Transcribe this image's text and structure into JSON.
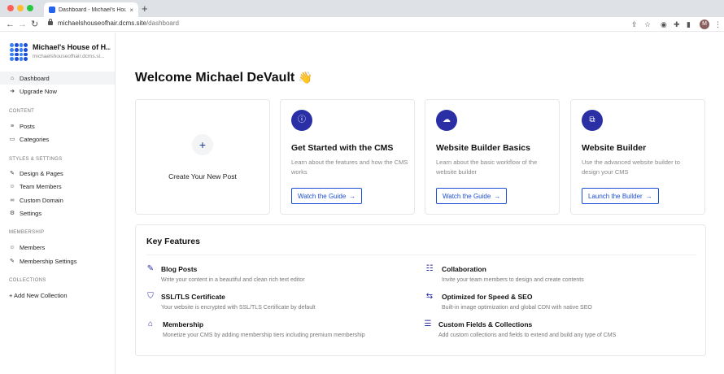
{
  "browser": {
    "tab_title": "Dashboard - Michael's House of",
    "tab_close": "×",
    "new_tab": "+",
    "url_host": "michaelshouseofhair.dcms.site",
    "url_path": "/dashboard",
    "avatar_initial": "M"
  },
  "sidebar": {
    "brand_name": "Michael's House of H...",
    "brand_domain": "michaelshouseofhair.dcms.si...",
    "top_items": [
      {
        "label": "Dashboard",
        "icon": "home-icon"
      },
      {
        "label": "Upgrade Now",
        "icon": "upgrade-icon"
      }
    ],
    "content_heading": "CONTENT",
    "content_items": [
      {
        "label": "Posts",
        "icon": "list-icon"
      },
      {
        "label": "Categories",
        "icon": "folder-icon"
      }
    ],
    "styles_heading": "STYLES & SETTINGS",
    "styles_items": [
      {
        "label": "Design & Pages",
        "icon": "pen-icon"
      },
      {
        "label": "Team Members",
        "icon": "users-icon"
      },
      {
        "label": "Custom Domain",
        "icon": "link-icon"
      },
      {
        "label": "Settings",
        "icon": "gear-icon"
      }
    ],
    "membership_heading": "MEMBERSHIP",
    "membership_items": [
      {
        "label": "Members",
        "icon": "users-icon"
      },
      {
        "label": "Membership Settings",
        "icon": "pen-icon"
      }
    ],
    "collections_heading": "COLLECTIONS",
    "add_collection": "+ Add New Collection"
  },
  "main": {
    "welcome": "Welcome Michael DeVault",
    "welcome_emoji": "👋",
    "new_post_plus": "+",
    "new_post_label": "Create Your New Post",
    "guides": [
      {
        "title": "Get Started with the CMS",
        "desc": "Learn about the features and how the CMS works",
        "button": "Watch the Guide",
        "arrow": "→",
        "icon": "info-icon"
      },
      {
        "title": "Website Builder Basics",
        "desc": "Learn about the basic workflow of the website builder",
        "button": "Watch the Guide",
        "arrow": "→",
        "icon": "cloud-icon"
      },
      {
        "title": "Website Builder",
        "desc": "Use the advanced website builder to design your CMS",
        "button": "Launch the Builder",
        "arrow": "→",
        "icon": "blocks-icon"
      }
    ],
    "key_features_title": "Key Features",
    "features": [
      {
        "title": "Blog Posts",
        "desc": "Write your content in a beautiful and clean rich text editor",
        "icon": "edit-icon"
      },
      {
        "title": "Collaboration",
        "desc": "Invite your team members to design and create contents",
        "icon": "team-icon"
      },
      {
        "title": "SSL/TLS Certificate",
        "desc": "Your website is encrypted with SSL/TLS Certificate by default",
        "icon": "shield-icon"
      },
      {
        "title": "Optimized for Speed & SEO",
        "desc": "Built-in image optimization and global CDN with native SEO",
        "icon": "handshake-icon"
      },
      {
        "title": "Membership",
        "desc": "Monetize your CMS by adding membership tiers including premium membership",
        "icon": "members-icon"
      },
      {
        "title": "Custom Fields & Collections",
        "desc": "Add custom collections and fields to extend and build any type of CMS",
        "icon": "database-icon"
      }
    ]
  },
  "colors": {
    "accent": "#1d4ed8",
    "icon_bg": "#2a2fa5",
    "active_nav_bg": "#f3f4f6"
  }
}
